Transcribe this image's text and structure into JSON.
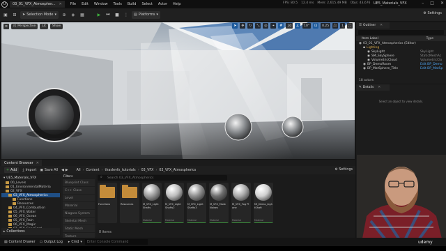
{
  "titlebar": {
    "logo": "U",
    "doc_tab": "03_01_VFX_Atmospher...",
    "menu": [
      "File",
      "Edit",
      "Window",
      "Tools",
      "Build",
      "Select",
      "Actor",
      "Help"
    ],
    "stats": [
      "FPS: 80.5",
      "12.4 ms",
      "Mem: 2,615.49 MB",
      "Objs: 43,676"
    ],
    "project": "UE5_Materials_VFX",
    "window_controls": [
      "–",
      "□",
      "✕"
    ]
  },
  "toolbar": {
    "selection_mode": "Selection Mode",
    "platforms": "Platforms",
    "settings": "Settings"
  },
  "viewport": {
    "perspective": "Perspective",
    "lit": "Lit",
    "show": "Show",
    "grid_value": "10",
    "angle_value": "10°",
    "scale_value": "0.25",
    "camera_value": "1"
  },
  "content_browser": {
    "tab": "Content Browser",
    "add": "Add",
    "import": "Import",
    "save_all": "Save All",
    "breadcrumbs": [
      "All",
      "Content",
      "thaslevfx_tutorials",
      "03_VFX",
      "03_VFX_Atmospherics"
    ],
    "settings": "Settings",
    "tree_root": "UE5_Materials_VFX",
    "tree_items": [
      {
        "label": "00_Levels",
        "selected": false
      },
      {
        "label": "01_EnvironmentalMateria",
        "selected": false
      },
      {
        "label": "02_VFX",
        "selected": false
      },
      {
        "label": "03_VFX_Atmospherics",
        "selected": true
      },
      {
        "label": "Functions",
        "selected": false
      },
      {
        "label": "Resources",
        "selected": false
      },
      {
        "label": "04_VFX_Combustion",
        "selected": false
      },
      {
        "label": "05_VFX_Water",
        "selected": false
      },
      {
        "label": "06_VFX_Ocean",
        "selected": false
      },
      {
        "label": "05_VFX_Rain",
        "selected": false
      },
      {
        "label": "06_VFX_Magic",
        "selected": false
      },
      {
        "label": "07_VFX_SnapCard",
        "selected": false
      }
    ],
    "collections": "Collections",
    "filters_title": "Filters",
    "filter_items": [
      "Blueprint Class",
      "C++ Class",
      "Level",
      "Material",
      "Niagara System",
      "Skeletal Mesh",
      "Static Mesh",
      "Texture"
    ],
    "search_placeholder": "Search 03_VFX_Atmospherics",
    "assets": [
      {
        "label": "Functions",
        "kind": "",
        "type": "folder"
      },
      {
        "label": "Resources",
        "kind": "",
        "type": "folder"
      },
      {
        "label": "M_VFX_Light Shafts",
        "kind": "Material",
        "type": "sphere",
        "tone": "#9a9a9a"
      },
      {
        "label": "M_VFX_Light Shafts2",
        "kind": "Material",
        "type": "sphere",
        "tone": "#bdbdbd"
      },
      {
        "label": "M_VFX_Light Shafts3",
        "kind": "Material",
        "type": "sphere",
        "tone": "#8d8d8d"
      },
      {
        "label": "M_VFX_Mask Noises",
        "kind": "Material",
        "type": "sphere",
        "tone": "#6e6e6e"
      },
      {
        "label": "M_VFX_Fog Plane",
        "kind": "Material",
        "type": "sphere",
        "tone": "#a8a8a8"
      },
      {
        "label": "MI_Demo_LightShaft",
        "kind": "Material",
        "type": "sphere",
        "tone": "#cfcfcf"
      }
    ],
    "items_count": "8 items"
  },
  "outliner": {
    "tab": "Outliner",
    "col_label": "Item Label",
    "col_type": "Type",
    "rows": [
      {
        "label": "03_01_VFX_Atmospherics (Editor)",
        "type": "",
        "indent": 0,
        "link": false
      },
      {
        "label": "Lighting",
        "type": "",
        "indent": 1,
        "link": false
      },
      {
        "label": "SkyLight",
        "type": "SkyLight",
        "indent": 2,
        "link": false
      },
      {
        "label": "SM_SkySphere",
        "type": "StaticMeshAc",
        "indent": 2,
        "link": false
      },
      {
        "label": "VolumetricCloud",
        "type": "VolumetricClo",
        "indent": 2,
        "link": false
      },
      {
        "label": "BP_DemoRoom",
        "type": "Edit BP_Demo",
        "indent": 1,
        "link": true
      },
      {
        "label": "BP_MatSphere_Title",
        "type": "Edit BP_MatSp",
        "indent": 1,
        "link": true
      }
    ],
    "actors_count": "18 actors"
  },
  "details": {
    "tab": "Details",
    "empty_text": "Select an object to view details."
  },
  "statusbar": {
    "content_drawer": "Content Drawer",
    "output_log": "Output Log",
    "cmd": "Cmd",
    "console_placeholder": "Enter Console Command",
    "watermark": "udemy"
  },
  "colors": {
    "accent_blue": "#1f4f86",
    "play_green": "#3fb43f",
    "folder": "#c48c3a"
  }
}
